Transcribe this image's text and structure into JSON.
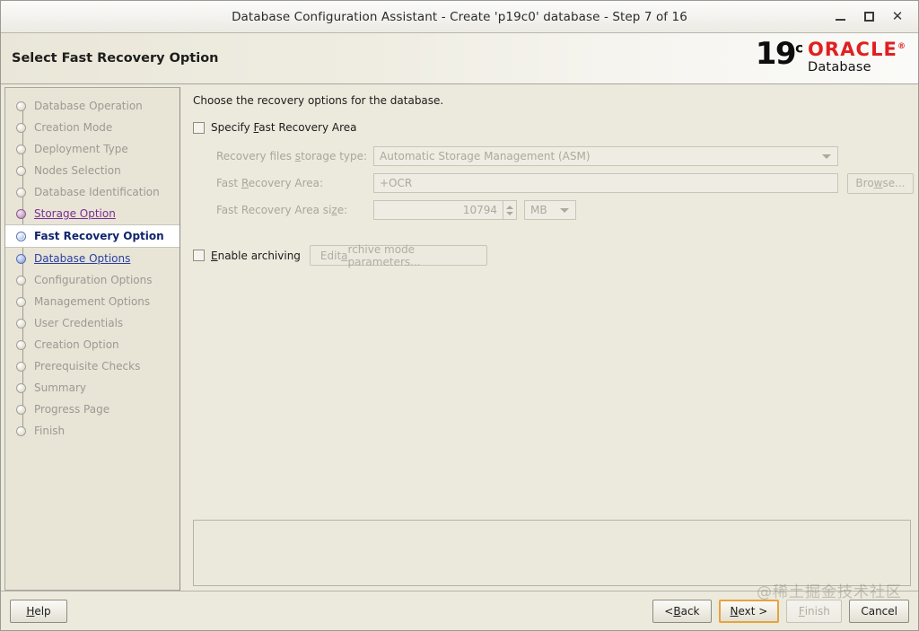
{
  "window": {
    "title": "Database Configuration Assistant - Create 'p19c0' database - Step 7 of 16",
    "controls": {
      "minimize": "–",
      "maximize": "□",
      "close": "✕"
    }
  },
  "header": {
    "page_title": "Select Fast Recovery Option",
    "logo": {
      "version": "19",
      "version_suffix": "c",
      "brand": "ORACLE",
      "registered": "®",
      "product": "Database",
      "brand_color": "#e02020"
    }
  },
  "sidebar": {
    "items": [
      {
        "label": "Database Operation",
        "state": "done"
      },
      {
        "label": "Creation Mode",
        "state": "done"
      },
      {
        "label": "Deployment Type",
        "state": "done"
      },
      {
        "label": "Nodes Selection",
        "state": "done"
      },
      {
        "label": "Database Identification",
        "state": "done"
      },
      {
        "label": "Storage Option",
        "state": "visited"
      },
      {
        "label": "Fast Recovery Option",
        "state": "current"
      },
      {
        "label": "Database Options",
        "state": "link"
      },
      {
        "label": "Configuration Options",
        "state": "pending"
      },
      {
        "label": "Management Options",
        "state": "pending"
      },
      {
        "label": "User Credentials",
        "state": "pending"
      },
      {
        "label": "Creation Option",
        "state": "pending"
      },
      {
        "label": "Prerequisite Checks",
        "state": "pending"
      },
      {
        "label": "Summary",
        "state": "pending"
      },
      {
        "label": "Progress Page",
        "state": "pending"
      },
      {
        "label": "Finish",
        "state": "pending"
      }
    ]
  },
  "main": {
    "intro": "Choose the recovery options for the database.",
    "specify_fra": {
      "label_pre": "Specify ",
      "label_mnemonic": "F",
      "label_post": "ast Recovery Area",
      "checked": false
    },
    "fields": {
      "storage_type": {
        "label_pre": "Recovery files ",
        "label_mnemonic": "s",
        "label_post": "torage type:",
        "value": "Automatic Storage Management (ASM)",
        "enabled": false
      },
      "fra_path": {
        "label_pre": "Fast ",
        "label_mnemonic": "R",
        "label_post": "ecovery Area:",
        "value": "+OCR",
        "enabled": false,
        "browse_label_pre": "Bro",
        "browse_label_mnemonic": "w",
        "browse_label_post": "se..."
      },
      "fra_size": {
        "label_pre": "Fast Recovery Area si",
        "label_mnemonic": "z",
        "label_post": "e:",
        "value": "10794",
        "unit": "MB",
        "enabled": false
      }
    },
    "enable_archiving": {
      "label_pre": "",
      "label_mnemonic": "E",
      "label_post": "nable archiving",
      "checked": false,
      "edit_btn_pre": "Edit ",
      "edit_btn_mnemonic": "a",
      "edit_btn_post": "rchive mode parameters..."
    },
    "message_panel_text": ""
  },
  "footer": {
    "help": {
      "pre": "",
      "mnemonic": "H",
      "post": "elp"
    },
    "back": {
      "pre": "< ",
      "mnemonic": "B",
      "post": "ack"
    },
    "next": {
      "pre": "",
      "mnemonic": "N",
      "post": "ext >"
    },
    "finish": {
      "pre": "",
      "mnemonic": "F",
      "post": "inish",
      "disabled": true
    },
    "cancel": {
      "pre": "Cancel",
      "mnemonic": "",
      "post": ""
    }
  },
  "watermark": "@稀土掘金技术社区"
}
